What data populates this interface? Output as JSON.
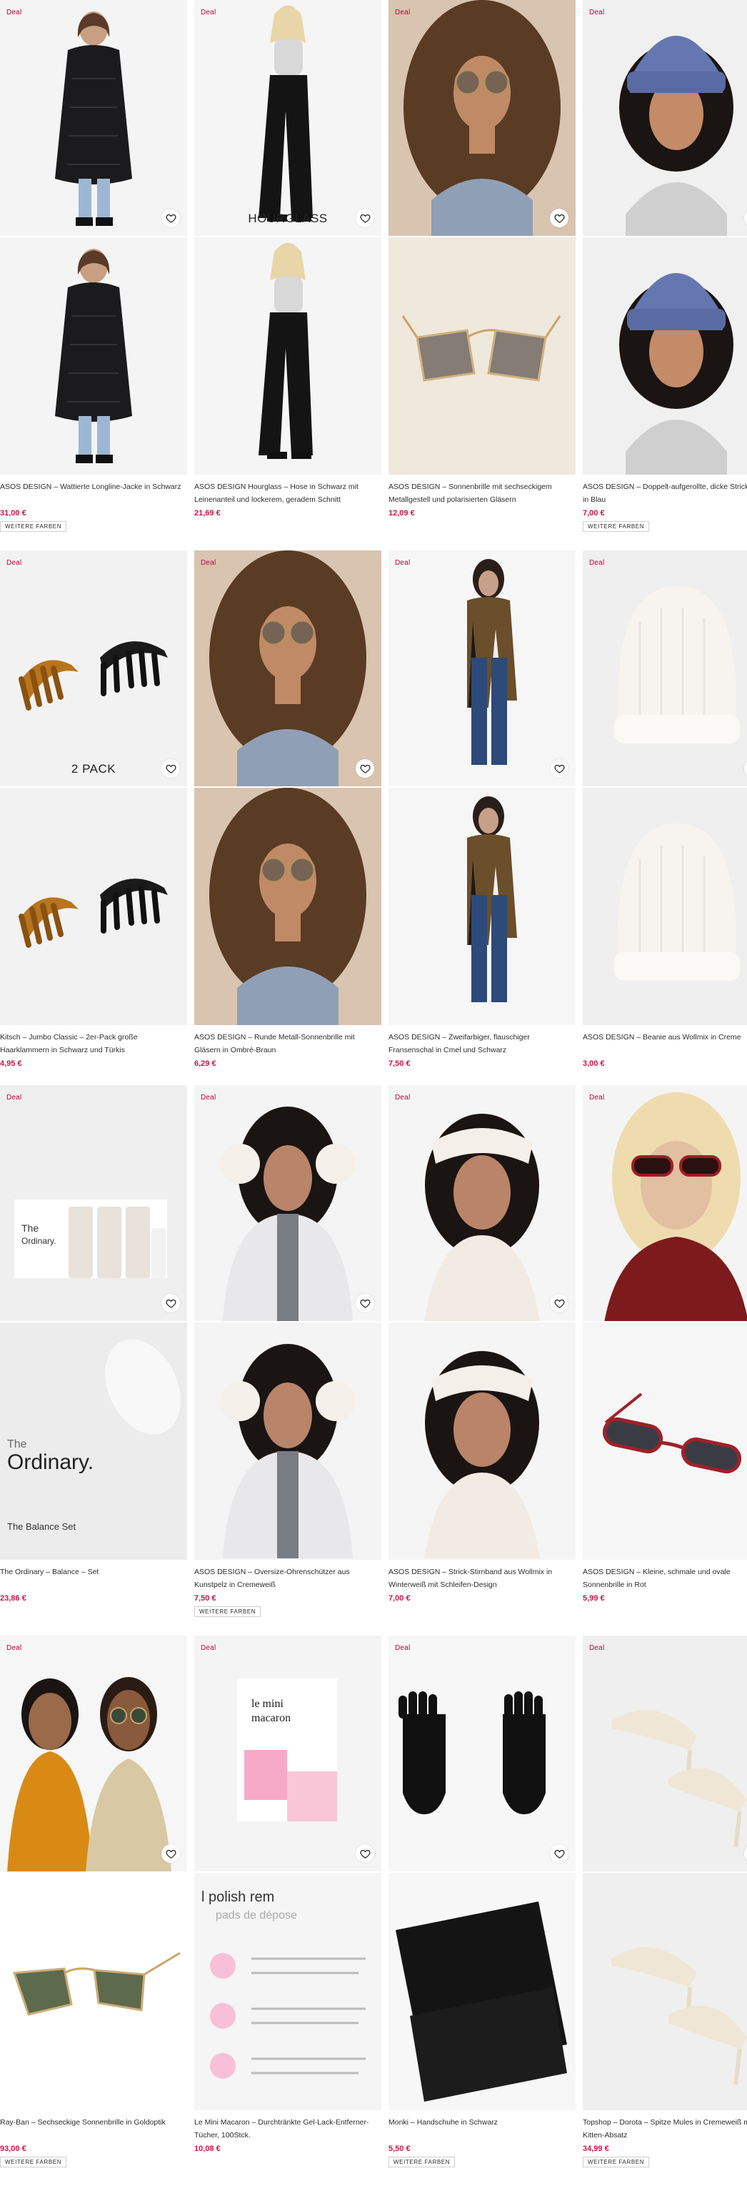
{
  "labels": {
    "deal": "Deal",
    "more_colors": "WEITERE FARBEN"
  },
  "products": [
    {
      "title": "ASOS DESIGN – Wattierte Longline-Jacke in Schwarz",
      "price": "31,00 €",
      "deal": true,
      "more_colors": true,
      "overlay": "",
      "h1": 174,
      "h2": 174,
      "info": 47,
      "v1": "coat",
      "v2": "coat"
    },
    {
      "title": "ASOS DESIGN Hourglass – Hose in Schwarz mit Leinenanteil und lockerem, geradem Schnitt",
      "price": "21,69 €",
      "deal": true,
      "more_colors": false,
      "overlay": "HOURGLASS",
      "h1": 174,
      "h2": 174,
      "info": 47,
      "v1": "pants",
      "v2": "pants"
    },
    {
      "title": "ASOS DESIGN – Sonnenbrille mit sechseckigem Metallgestell und polarisierten Gläsern",
      "price": "12,09 €",
      "deal": true,
      "more_colors": false,
      "overlay": "",
      "h1": 174,
      "h2": 174,
      "info": 47,
      "v1": "curlyhair",
      "v2": "sunglasses_gold"
    },
    {
      "title": "ASOS DESIGN – Doppelt-aufgerollte, dicke Strickmütze in Blau",
      "price": "7,00 €",
      "deal": true,
      "more_colors": true,
      "overlay": "",
      "h1": 174,
      "h2": 174,
      "info": 47,
      "v1": "beanie_blue",
      "v2": "beanie_blue"
    },
    {
      "title": "Kitsch – Jumbo Classic – 2er-Pack große Haarklammern in Schwarz und Türkis",
      "price": "4,95 €",
      "deal": true,
      "more_colors": false,
      "overlay": "2 PACK",
      "h1": 174,
      "h2": 174,
      "info": 36,
      "v1": "clips",
      "v2": "clips"
    },
    {
      "title": "ASOS DESIGN – Runde Metall-Sonnenbrille mit Gläsern in Ombré-Braun",
      "price": "6,29 €",
      "deal": true,
      "more_colors": false,
      "overlay": "",
      "h1": 174,
      "h2": 174,
      "info": 36,
      "v1": "curlyhair",
      "v2": "curlyhair"
    },
    {
      "title": "ASOS DESIGN – Zweifarbiger, flauschiger Fransenschal in Cmel und Schwarz",
      "price": "7,50 €",
      "deal": true,
      "more_colors": false,
      "overlay": "",
      "h1": 174,
      "h2": 174,
      "info": 36,
      "v1": "scarf",
      "v2": "scarf"
    },
    {
      "title": "ASOS DESIGN – Beanie aus Wollmix in Creme",
      "price": "3,00 €",
      "deal": true,
      "more_colors": false,
      "overlay": "",
      "h1": 174,
      "h2": 174,
      "info": 36,
      "v1": "beanie_cream",
      "v2": "beanie_cream"
    },
    {
      "title": "The Ordinary – Balance – Set",
      "price": "23,86 €",
      "deal": true,
      "more_colors": false,
      "overlay": "",
      "h1": 174,
      "h2": 174,
      "info": 47,
      "v1": "ordinary",
      "v2": "ordinary_box"
    },
    {
      "title": "ASOS DESIGN – Oversize-Ohrenschützer aus Kunstpelz in Cremeweiß",
      "price": "7,50 €",
      "deal": true,
      "more_colors": true,
      "overlay": "",
      "h1": 174,
      "h2": 174,
      "info": 47,
      "v1": "earmuffs",
      "v2": "earmuffs"
    },
    {
      "title": "ASOS DESIGN – Strick-Stirnband aus Wollmix in Winterweiß mit Schleifen-Design",
      "price": "7,00 €",
      "deal": true,
      "more_colors": false,
      "overlay": "",
      "h1": 174,
      "h2": 174,
      "info": 47,
      "v1": "headband",
      "v2": "headband"
    },
    {
      "title": "ASOS DESIGN – Kleine, schmale und ovale Sonnenbrille in Rot",
      "price": "5,99 €",
      "deal": true,
      "more_colors": false,
      "overlay": "",
      "h1": 174,
      "h2": 174,
      "info": 47,
      "v1": "blonde",
      "v2": "redglasses"
    },
    {
      "title": "Ray-Ban – Sechseckige Sonnenbrille in Goldoptik",
      "price": "93,00 €",
      "deal": true,
      "more_colors": true,
      "overlay": "",
      "h1": 174,
      "h2": 174,
      "info": 47,
      "v1": "couple",
      "v2": "rayban"
    },
    {
      "title": "Le Mini Macaron – Durchtränkte Gel-Lack-Entferner-Tücher, 100Stck.",
      "price": "10,08 €",
      "deal": true,
      "more_colors": false,
      "overlay": "",
      "h1": 174,
      "h2": 174,
      "info": 47,
      "v1": "macaron",
      "v2": "macaron_pad"
    },
    {
      "title": "Monki – Handschuhe in Schwarz",
      "price": "5,50 €",
      "deal": true,
      "more_colors": true,
      "overlay": "",
      "h1": 174,
      "h2": 174,
      "info": 47,
      "v1": "gloves",
      "v2": "gloves2"
    },
    {
      "title": "Topshop – Dorota – Spitze Mules in Cremeweiß mit Kitten-Absatz",
      "price": "34,99 €",
      "deal": true,
      "more_colors": true,
      "overlay": "",
      "h1": 174,
      "h2": 174,
      "info": 47,
      "v1": "mules",
      "v2": "mules"
    }
  ],
  "colors": {
    "deal": "#c0003c",
    "price": "#d01345",
    "text": "#2d2d2d"
  }
}
